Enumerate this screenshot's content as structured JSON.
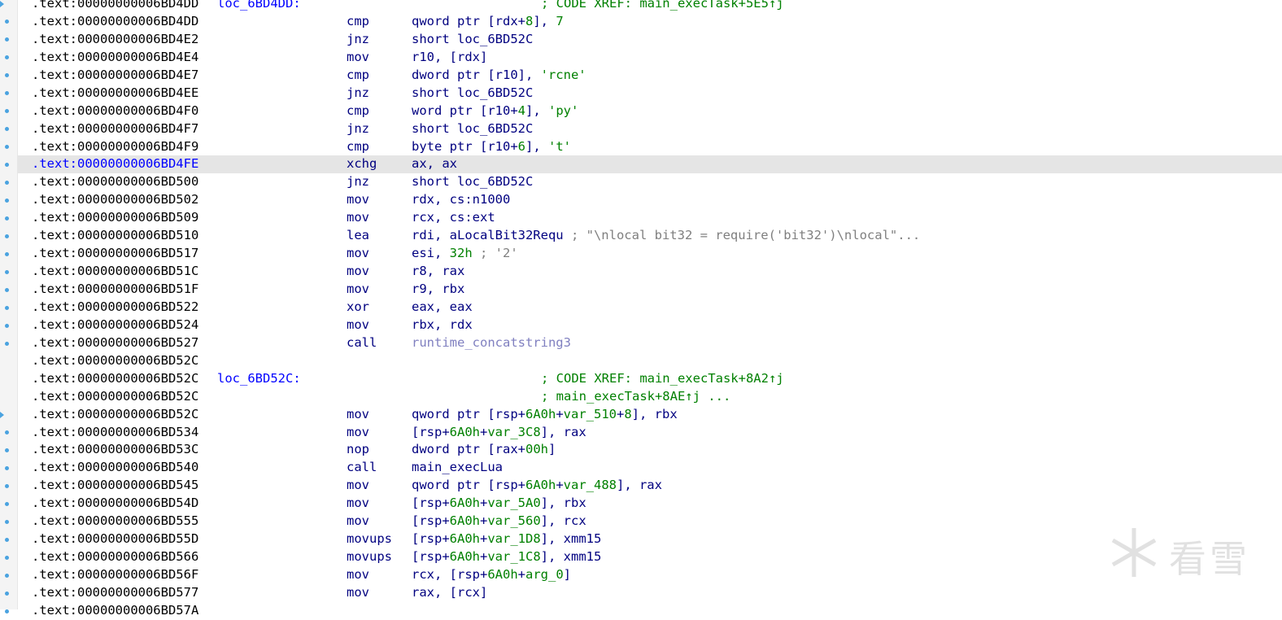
{
  "listing": {
    "rows": [
      {
        "addr": ".text:00000000006BD4DD",
        "label": "loc_6BD4DD:",
        "cmt": "; CODE XREF: main_execTask+5E5↑j"
      },
      {
        "addr": ".text:00000000006BD4DD",
        "mn": "cmp",
        "ops": [
          {
            "t": "qword ptr [rdx+"
          },
          {
            "t": "8",
            "c": "num"
          },
          {
            "t": "], "
          },
          {
            "t": "7",
            "c": "num"
          }
        ]
      },
      {
        "addr": ".text:00000000006BD4E2",
        "mn": "jnz",
        "ops": [
          {
            "t": "short loc_6BD52C"
          }
        ]
      },
      {
        "addr": ".text:00000000006BD4E4",
        "mn": "mov",
        "ops": [
          {
            "t": "r10, [rdx]"
          }
        ]
      },
      {
        "addr": ".text:00000000006BD4E7",
        "mn": "cmp",
        "ops": [
          {
            "t": "dword ptr [r10], "
          },
          {
            "t": "'rcne'",
            "c": "str"
          }
        ]
      },
      {
        "addr": ".text:00000000006BD4EE",
        "mn": "jnz",
        "ops": [
          {
            "t": "short loc_6BD52C"
          }
        ]
      },
      {
        "addr": ".text:00000000006BD4F0",
        "mn": "cmp",
        "ops": [
          {
            "t": "word ptr [r10+"
          },
          {
            "t": "4",
            "c": "num"
          },
          {
            "t": "], "
          },
          {
            "t": "'py'",
            "c": "str"
          }
        ]
      },
      {
        "addr": ".text:00000000006BD4F7",
        "mn": "jnz",
        "ops": [
          {
            "t": "short loc_6BD52C"
          }
        ]
      },
      {
        "addr": ".text:00000000006BD4F9",
        "mn": "cmp",
        "ops": [
          {
            "t": "byte ptr [r10+"
          },
          {
            "t": "6",
            "c": "num"
          },
          {
            "t": "], "
          },
          {
            "t": "'t'",
            "c": "str"
          }
        ]
      },
      {
        "addr": ".text:00000000006BD4FE",
        "mn": "xchg",
        "ops": [
          {
            "t": "ax, ax"
          }
        ],
        "hl": true
      },
      {
        "addr": ".text:00000000006BD500",
        "mn": "jnz",
        "ops": [
          {
            "t": "short loc_6BD52C"
          }
        ]
      },
      {
        "addr": ".text:00000000006BD502",
        "mn": "mov",
        "ops": [
          {
            "t": "rdx, cs:n1000"
          }
        ]
      },
      {
        "addr": ".text:00000000006BD509",
        "mn": "mov",
        "ops": [
          {
            "t": "rcx, cs:ext"
          }
        ]
      },
      {
        "addr": ".text:00000000006BD510",
        "mn": "lea",
        "ops": [
          {
            "t": "rdi, aLocalBit32Requ "
          },
          {
            "t": "; \"\\nlocal bit32 = require('bit32')\\nlocal\"...",
            "c": "gcmt"
          }
        ]
      },
      {
        "addr": ".text:00000000006BD517",
        "mn": "mov",
        "ops": [
          {
            "t": "esi, "
          },
          {
            "t": "32h",
            "c": "num"
          },
          {
            "t": " ; '2'",
            "c": "gcmt"
          }
        ]
      },
      {
        "addr": ".text:00000000006BD51C",
        "mn": "mov",
        "ops": [
          {
            "t": "r8, rax"
          }
        ]
      },
      {
        "addr": ".text:00000000006BD51F",
        "mn": "mov",
        "ops": [
          {
            "t": "r9, rbx"
          }
        ]
      },
      {
        "addr": ".text:00000000006BD522",
        "mn": "xor",
        "ops": [
          {
            "t": "eax, eax"
          }
        ]
      },
      {
        "addr": ".text:00000000006BD524",
        "mn": "mov",
        "ops": [
          {
            "t": "rbx, rdx"
          }
        ]
      },
      {
        "addr": ".text:00000000006BD527",
        "mn": "call",
        "ops": [
          {
            "t": "runtime_concatstring3",
            "c": "ext"
          }
        ]
      },
      {
        "addr": ".text:00000000006BD52C"
      },
      {
        "addr": ".text:00000000006BD52C",
        "label": "loc_6BD52C:",
        "cmt": "; CODE XREF: main_execTask+8A2↑j"
      },
      {
        "addr": ".text:00000000006BD52C",
        "cmt": "; main_execTask+8AE↑j ..."
      },
      {
        "addr": ".text:00000000006BD52C",
        "mn": "mov",
        "ops": [
          {
            "t": "qword ptr [rsp+"
          },
          {
            "t": "6A0h",
            "c": "num"
          },
          {
            "t": "+"
          },
          {
            "t": "var_510",
            "c": "num"
          },
          {
            "t": "+"
          },
          {
            "t": "8",
            "c": "num"
          },
          {
            "t": "], rbx"
          }
        ]
      },
      {
        "addr": ".text:00000000006BD534",
        "mn": "mov",
        "ops": [
          {
            "t": "[rsp+"
          },
          {
            "t": "6A0h",
            "c": "num"
          },
          {
            "t": "+"
          },
          {
            "t": "var_3C8",
            "c": "num"
          },
          {
            "t": "], rax"
          }
        ]
      },
      {
        "addr": ".text:00000000006BD53C",
        "mn": "nop",
        "ops": [
          {
            "t": "dword ptr [rax+"
          },
          {
            "t": "00h",
            "c": "num"
          },
          {
            "t": "]"
          }
        ]
      },
      {
        "addr": ".text:00000000006BD540",
        "mn": "call",
        "ops": [
          {
            "t": "main_execLua"
          }
        ]
      },
      {
        "addr": ".text:00000000006BD545",
        "mn": "mov",
        "ops": [
          {
            "t": "qword ptr [rsp+"
          },
          {
            "t": "6A0h",
            "c": "num"
          },
          {
            "t": "+"
          },
          {
            "t": "var_488",
            "c": "num"
          },
          {
            "t": "], rax"
          }
        ]
      },
      {
        "addr": ".text:00000000006BD54D",
        "mn": "mov",
        "ops": [
          {
            "t": "[rsp+"
          },
          {
            "t": "6A0h",
            "c": "num"
          },
          {
            "t": "+"
          },
          {
            "t": "var_5A0",
            "c": "num"
          },
          {
            "t": "], rbx"
          }
        ]
      },
      {
        "addr": ".text:00000000006BD555",
        "mn": "mov",
        "ops": [
          {
            "t": "[rsp+"
          },
          {
            "t": "6A0h",
            "c": "num"
          },
          {
            "t": "+"
          },
          {
            "t": "var_560",
            "c": "num"
          },
          {
            "t": "], rcx"
          }
        ]
      },
      {
        "addr": ".text:00000000006BD55D",
        "mn": "movups",
        "ops": [
          {
            "t": "[rsp+"
          },
          {
            "t": "6A0h",
            "c": "num"
          },
          {
            "t": "+"
          },
          {
            "t": "var_1D8",
            "c": "num"
          },
          {
            "t": "], xmm15"
          }
        ]
      },
      {
        "addr": ".text:00000000006BD566",
        "mn": "movups",
        "ops": [
          {
            "t": "[rsp+"
          },
          {
            "t": "6A0h",
            "c": "num"
          },
          {
            "t": "+"
          },
          {
            "t": "var_1C8",
            "c": "num"
          },
          {
            "t": "], xmm15"
          }
        ]
      },
      {
        "addr": ".text:00000000006BD56F",
        "mn": "mov",
        "ops": [
          {
            "t": "rcx, [rsp+"
          },
          {
            "t": "6A0h",
            "c": "num"
          },
          {
            "t": "+"
          },
          {
            "t": "arg_0",
            "c": "num"
          },
          {
            "t": "]"
          }
        ]
      },
      {
        "addr": ".text:00000000006BD577",
        "mn": "mov",
        "ops": [
          {
            "t": "rax, [rcx]"
          }
        ]
      },
      {
        "addr": ".text:00000000006BD57A",
        "mn": "",
        "ops": []
      }
    ]
  },
  "gutter": {
    "markers": [
      "arrow",
      "dot",
      "dot",
      "dot",
      "dot",
      "dot",
      "dot",
      "dot",
      "dot",
      "dot",
      "dot",
      "dot",
      "dot",
      "dot",
      "dot",
      "dot",
      "dot",
      "dot",
      "dot",
      "dot",
      "none",
      "none",
      "none",
      "arrow",
      "dot",
      "dot",
      "dot",
      "dot",
      "dot",
      "dot",
      "dot",
      "dot",
      "dot",
      "dot",
      "dot"
    ]
  },
  "watermark": {
    "text": "看雪"
  },
  "colors": {
    "address": "#000000",
    "mnemonic": "#000080",
    "label": "#0000ff",
    "number": "#008000",
    "comment": "#7f7f7f",
    "xref": "#008000",
    "highlight": "#e5e5e5",
    "marker": "#4aa3e0"
  }
}
